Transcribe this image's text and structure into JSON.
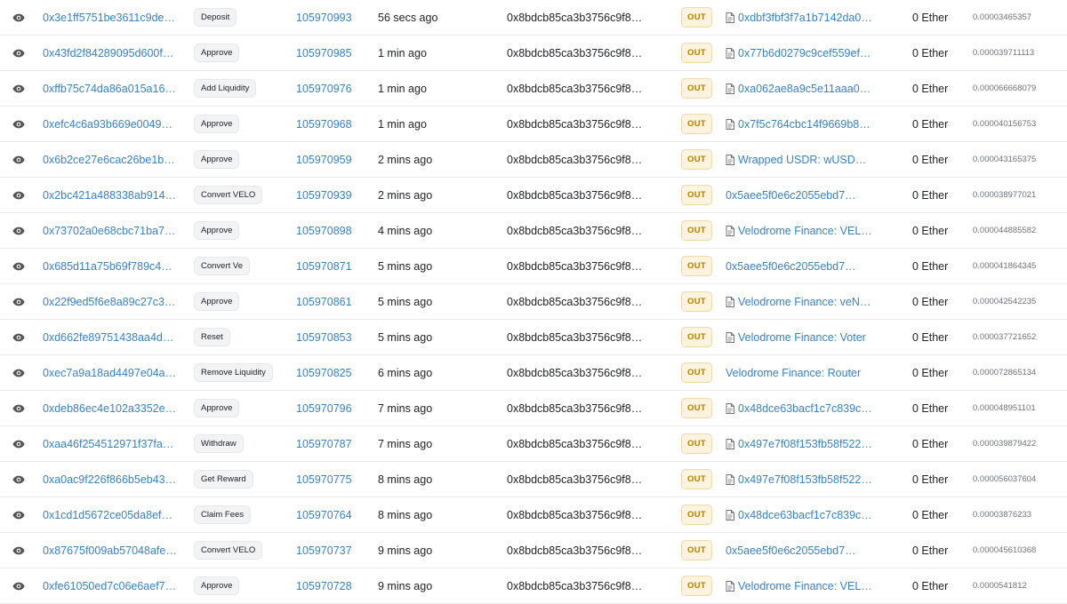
{
  "rows": [
    {
      "hash": "0x3e1ff5751be3611c9de…",
      "method": "Deposit",
      "block": "105970993",
      "age": "56 secs ago",
      "from": "0x8bdcb85ca3b3756c9f8…",
      "direction": "OUT",
      "to": "0xdbf3fbf3f7a1b7142da0…",
      "to_is_contract": true,
      "value": "0 Ether",
      "fee": "0.00003465357"
    },
    {
      "hash": "0x43fd2f84289095d600f…",
      "method": "Approve",
      "block": "105970985",
      "age": "1 min ago",
      "from": "0x8bdcb85ca3b3756c9f8…",
      "direction": "OUT",
      "to": "0x77b6d0279c9cef559ef…",
      "to_is_contract": true,
      "value": "0 Ether",
      "fee": "0.000039711113"
    },
    {
      "hash": "0xffb75c74da86a015a16…",
      "method": "Add Liquidity",
      "block": "105970976",
      "age": "1 min ago",
      "from": "0x8bdcb85ca3b3756c9f8…",
      "direction": "OUT",
      "to": "0xa062ae8a9c5e11aaa0…",
      "to_is_contract": true,
      "value": "0 Ether",
      "fee": "0.000066668079"
    },
    {
      "hash": "0xefc4c6a93b669e0049…",
      "method": "Approve",
      "block": "105970968",
      "age": "1 min ago",
      "from": "0x8bdcb85ca3b3756c9f8…",
      "direction": "OUT",
      "to": "0x7f5c764cbc14f9669b8…",
      "to_is_contract": true,
      "value": "0 Ether",
      "fee": "0.000040156753"
    },
    {
      "hash": "0x6b2ce27e6cac26be1b…",
      "method": "Approve",
      "block": "105970959",
      "age": "2 mins ago",
      "from": "0x8bdcb85ca3b3756c9f8…",
      "direction": "OUT",
      "to": "Wrapped USDR: wUSD…",
      "to_is_contract": true,
      "value": "0 Ether",
      "fee": "0.000043165375"
    },
    {
      "hash": "0x2bc421a488338ab914…",
      "method": "Convert VELO",
      "block": "105970939",
      "age": "2 mins ago",
      "from": "0x8bdcb85ca3b3756c9f8…",
      "direction": "OUT",
      "to": "0x5aee5f0e6c2055ebd7…",
      "to_is_contract": false,
      "value": "0 Ether",
      "fee": "0.000038977021"
    },
    {
      "hash": "0x73702a0e68cbc71ba7…",
      "method": "Approve",
      "block": "105970898",
      "age": "4 mins ago",
      "from": "0x8bdcb85ca3b3756c9f8…",
      "direction": "OUT",
      "to": "Velodrome Finance: VEL…",
      "to_is_contract": true,
      "value": "0 Ether",
      "fee": "0.000044885582"
    },
    {
      "hash": "0x685d11a75b69f789c4…",
      "method": "Convert Ve",
      "block": "105970871",
      "age": "5 mins ago",
      "from": "0x8bdcb85ca3b3756c9f8…",
      "direction": "OUT",
      "to": "0x5aee5f0e6c2055ebd7…",
      "to_is_contract": false,
      "value": "0 Ether",
      "fee": "0.000041864345"
    },
    {
      "hash": "0x22f9ed5f6e8a89c27c3…",
      "method": "Approve",
      "block": "105970861",
      "age": "5 mins ago",
      "from": "0x8bdcb85ca3b3756c9f8…",
      "direction": "OUT",
      "to": "Velodrome Finance: veN…",
      "to_is_contract": true,
      "value": "0 Ether",
      "fee": "0.000042542235"
    },
    {
      "hash": "0xd662fe89751438aa4d…",
      "method": "Reset",
      "block": "105970853",
      "age": "5 mins ago",
      "from": "0x8bdcb85ca3b3756c9f8…",
      "direction": "OUT",
      "to": "Velodrome Finance: Voter",
      "to_is_contract": true,
      "value": "0 Ether",
      "fee": "0.000037721652"
    },
    {
      "hash": "0xec7a9a18ad4497e04a…",
      "method": "Remove Liquidity",
      "block": "105970825",
      "age": "6 mins ago",
      "from": "0x8bdcb85ca3b3756c9f8…",
      "direction": "OUT",
      "to": "Velodrome Finance: Router",
      "to_is_contract": false,
      "value": "0 Ether",
      "fee": "0.000072865134"
    },
    {
      "hash": "0xdeb86ec4e102a3352e…",
      "method": "Approve",
      "block": "105970796",
      "age": "7 mins ago",
      "from": "0x8bdcb85ca3b3756c9f8…",
      "direction": "OUT",
      "to": "0x48dce63bacf1c7c839c…",
      "to_is_contract": true,
      "value": "0 Ether",
      "fee": "0.000048951101"
    },
    {
      "hash": "0xaa46f254512971f37fa…",
      "method": "Withdraw",
      "block": "105970787",
      "age": "7 mins ago",
      "from": "0x8bdcb85ca3b3756c9f8…",
      "direction": "OUT",
      "to": "0x497e7f08f153fb58f522…",
      "to_is_contract": true,
      "value": "0 Ether",
      "fee": "0.000039879422"
    },
    {
      "hash": "0xa0ac9f226f866b5eb43…",
      "method": "Get Reward",
      "block": "105970775",
      "age": "8 mins ago",
      "from": "0x8bdcb85ca3b3756c9f8…",
      "direction": "OUT",
      "to": "0x497e7f08f153fb58f522…",
      "to_is_contract": true,
      "value": "0 Ether",
      "fee": "0.000056037604"
    },
    {
      "hash": "0x1cd1d5672ce05da8ef…",
      "method": "Claim Fees",
      "block": "105970764",
      "age": "8 mins ago",
      "from": "0x8bdcb85ca3b3756c9f8…",
      "direction": "OUT",
      "to": "0x48dce63bacf1c7c839c…",
      "to_is_contract": true,
      "value": "0 Ether",
      "fee": "0.00003876233"
    },
    {
      "hash": "0x87675f009ab57048afe…",
      "method": "Convert VELO",
      "block": "105970737",
      "age": "9 mins ago",
      "from": "0x8bdcb85ca3b3756c9f8…",
      "direction": "OUT",
      "to": "0x5aee5f0e6c2055ebd7…",
      "to_is_contract": false,
      "value": "0 Ether",
      "fee": "0.000045610368"
    },
    {
      "hash": "0xfe61050ed7c06e6aef7…",
      "method": "Approve",
      "block": "105970728",
      "age": "9 mins ago",
      "from": "0x8bdcb85ca3b3756c9f8…",
      "direction": "OUT",
      "to": "Velodrome Finance: VEL…",
      "to_is_contract": true,
      "value": "0 Ether",
      "fee": "0.0000541812"
    }
  ],
  "icons": {
    "view": "eye-icon",
    "contract": "document-icon"
  },
  "colors": {
    "link": "#3b82c4",
    "out_badge_bg": "#fdf3df",
    "out_badge_text": "#b47d00",
    "method_badge_bg": "#f1f3f5"
  }
}
